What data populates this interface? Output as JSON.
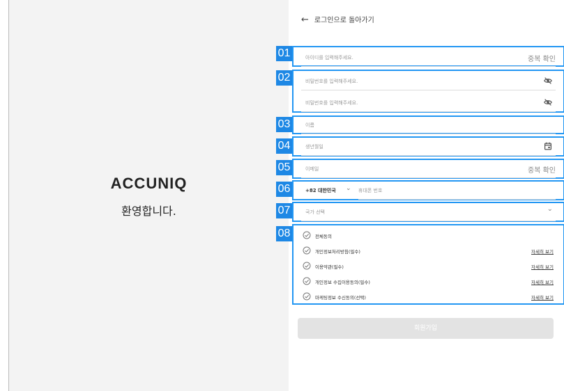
{
  "brand": {
    "logo": "ACCUNIQ",
    "welcome": "환영합니다."
  },
  "back": {
    "arrow": "←",
    "label": "로그인으로 돌아가기"
  },
  "markers": [
    "01",
    "02",
    "03",
    "04",
    "05",
    "06",
    "07",
    "08"
  ],
  "form": {
    "id_placeholder": "아이디를 입력해주세요.",
    "id_check": "중복 확인",
    "password_placeholder": "비밀번호를 입력해주세요.",
    "password_confirm_placeholder": "비밀번호를 입력해주세요.",
    "name_placeholder": "이름",
    "birth_placeholder": "생년월일",
    "email_placeholder": "이메일",
    "email_check": "중복 확인",
    "phone_code": "+82 대한민국",
    "phone_chevron": "⌄",
    "phone_placeholder": "휴대폰 번호",
    "country_placeholder": "국가 선택",
    "country_chevron": "⌄"
  },
  "agreements": {
    "all": "전체동의",
    "items": [
      {
        "label": "개인정보처리방침(필수)",
        "link": "자세히 보기"
      },
      {
        "label": "이용약관(필수)",
        "link": "자세히 보기"
      },
      {
        "label": "개인정보 수집이용동의(필수)",
        "link": "자세히 보기"
      },
      {
        "label": "마케팅정보 수신동의(선택)",
        "link": "자세히 보기"
      }
    ]
  },
  "submit_label": "회원가입",
  "colors": {
    "accent": "#2196f3",
    "marker": "#1e88e5",
    "panel": "#f3f3f3",
    "button_disabled": "#e3e3e3"
  },
  "icons": {
    "eye_off": "eye-off-icon",
    "calendar": "calendar-icon",
    "check": "check-circle-icon",
    "back": "arrow-left-icon"
  }
}
